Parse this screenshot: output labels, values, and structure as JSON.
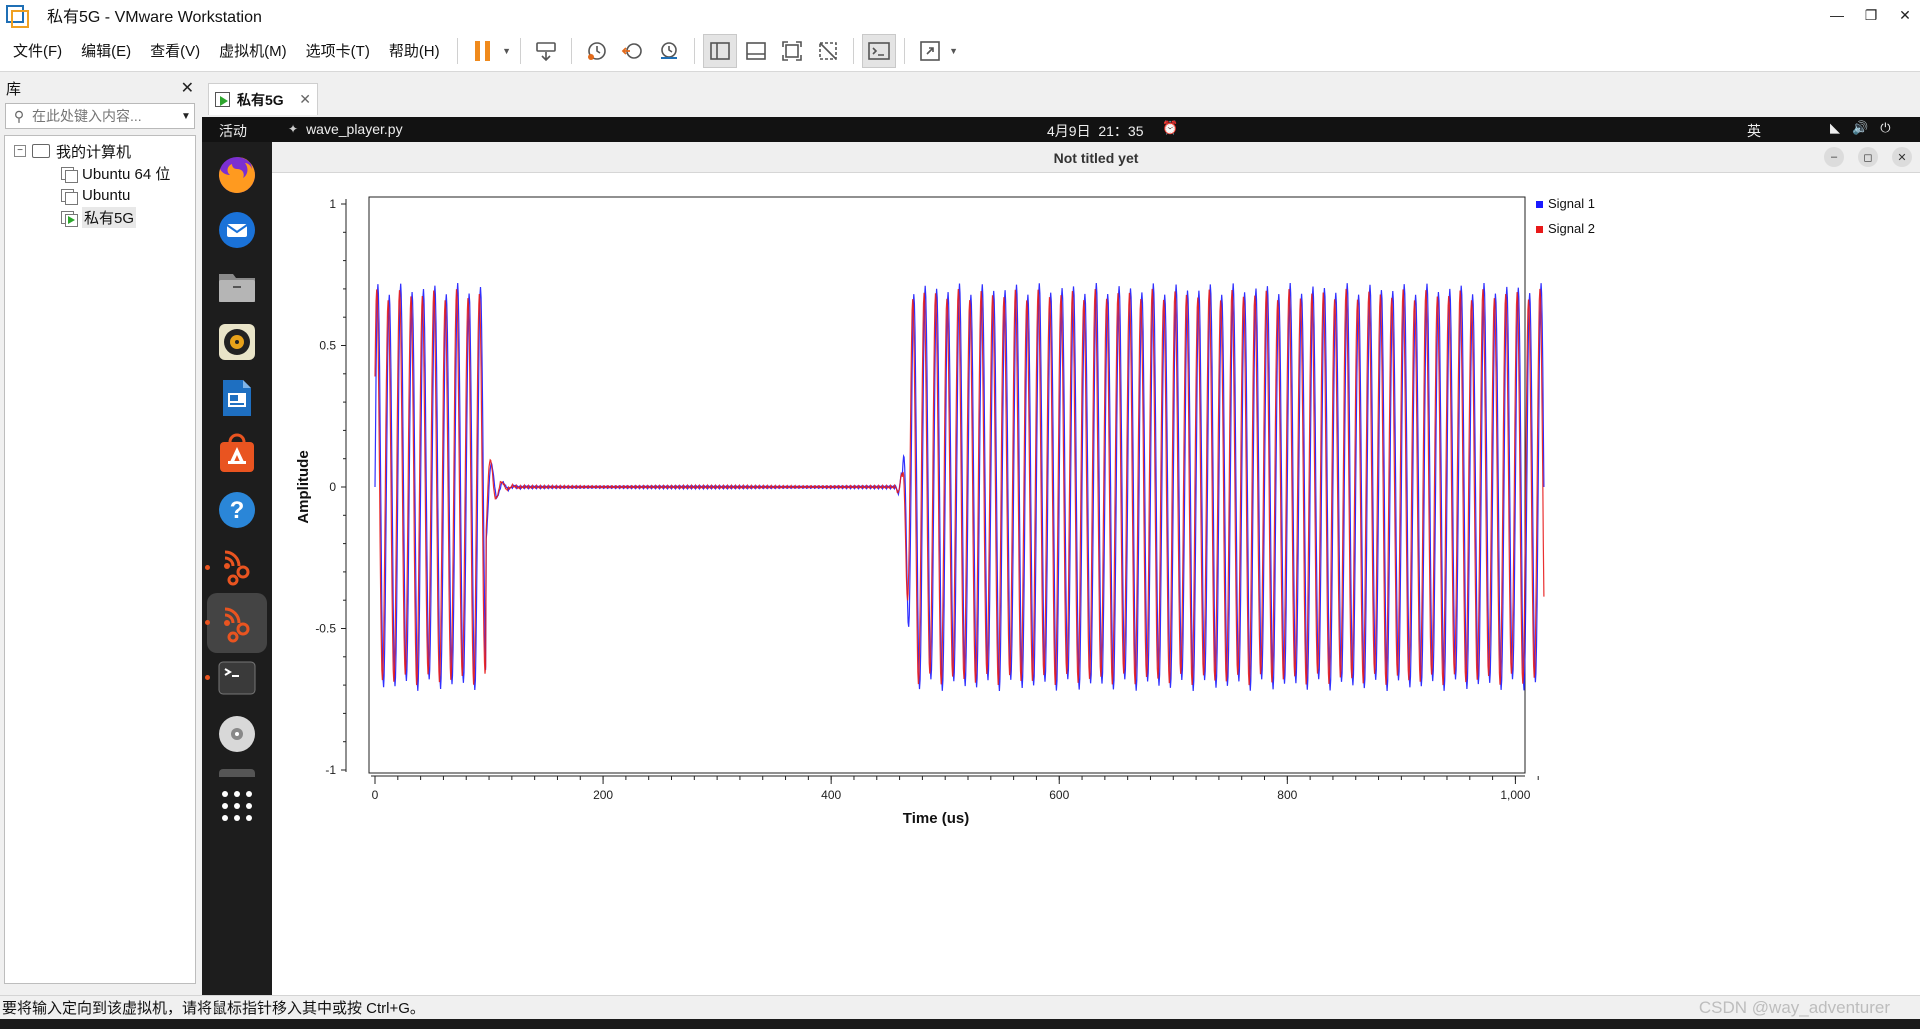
{
  "window": {
    "title": "私有5G - VMware Workstation"
  },
  "menu": {
    "items": [
      "文件(F)",
      "编辑(E)",
      "查看(V)",
      "虚拟机(M)",
      "选项卡(T)",
      "帮助(H)"
    ]
  },
  "library": {
    "title": "库",
    "search_placeholder": "在此处键入内容...",
    "tree": {
      "root": "我的计算机",
      "vms": [
        "Ubuntu 64 位",
        "Ubuntu",
        "私有5G"
      ]
    }
  },
  "tabs": [
    {
      "label": "私有5G"
    }
  ],
  "guest": {
    "topbar": {
      "activities": "活动",
      "app_name": "wave_player.py",
      "clock": "4月9日  21：35",
      "input_method": "英"
    },
    "dock_icons": [
      "firefox-icon",
      "thunderbird-icon",
      "files-icon",
      "rhythmbox-icon",
      "libreoffice-writer-icon",
      "app-center-icon",
      "help-icon",
      "gnuradio-icon",
      "gnuradio-active-icon",
      "terminal-icon",
      "dvd-icon",
      "show-apps-icon"
    ],
    "plot_window": {
      "title": "Not titled yet"
    }
  },
  "status": {
    "message": "要将输入定向到该虚拟机，请将鼠标指针移入其中或按 Ctrl+G。",
    "watermark": "CSDN @way_adventurer"
  },
  "colors": {
    "signal1": "#1a1aff",
    "signal2": "#e81919",
    "ubuntu_orange": "#e95420"
  },
  "chart_data": {
    "type": "line",
    "title": "",
    "xlabel": "Time (us)",
    "ylabel": "Amplitude",
    "xlim": [
      0,
      1030
    ],
    "ylim": [
      -1,
      1
    ],
    "x_ticks": [
      0,
      200,
      400,
      600,
      800,
      1000
    ],
    "x_tick_labels": [
      "0",
      "200",
      "400",
      "600",
      "800",
      "1,000"
    ],
    "y_ticks": [
      1,
      0.5,
      0,
      -0.5,
      -1
    ],
    "y_tick_labels": [
      "1",
      "0.5",
      "0",
      "-0.5",
      "-1"
    ],
    "legend": "top-right",
    "grid": false,
    "series": [
      {
        "name": "Signal 1",
        "color": "#1a1aff",
        "amplitude": 0.7,
        "cycles_per_us": 0.1,
        "phase": 0.0
      },
      {
        "name": "Signal 2",
        "color": "#e81919",
        "amplitude": 0.68,
        "cycles_per_us": 0.1,
        "phase": 0.6
      }
    ],
    "segments": [
      {
        "x_start": 0,
        "x_end": 97,
        "state": "tone"
      },
      {
        "x_start": 97,
        "x_end": 462,
        "state": "silence"
      },
      {
        "x_start": 462,
        "x_end": 1025,
        "state": "tone"
      }
    ]
  }
}
